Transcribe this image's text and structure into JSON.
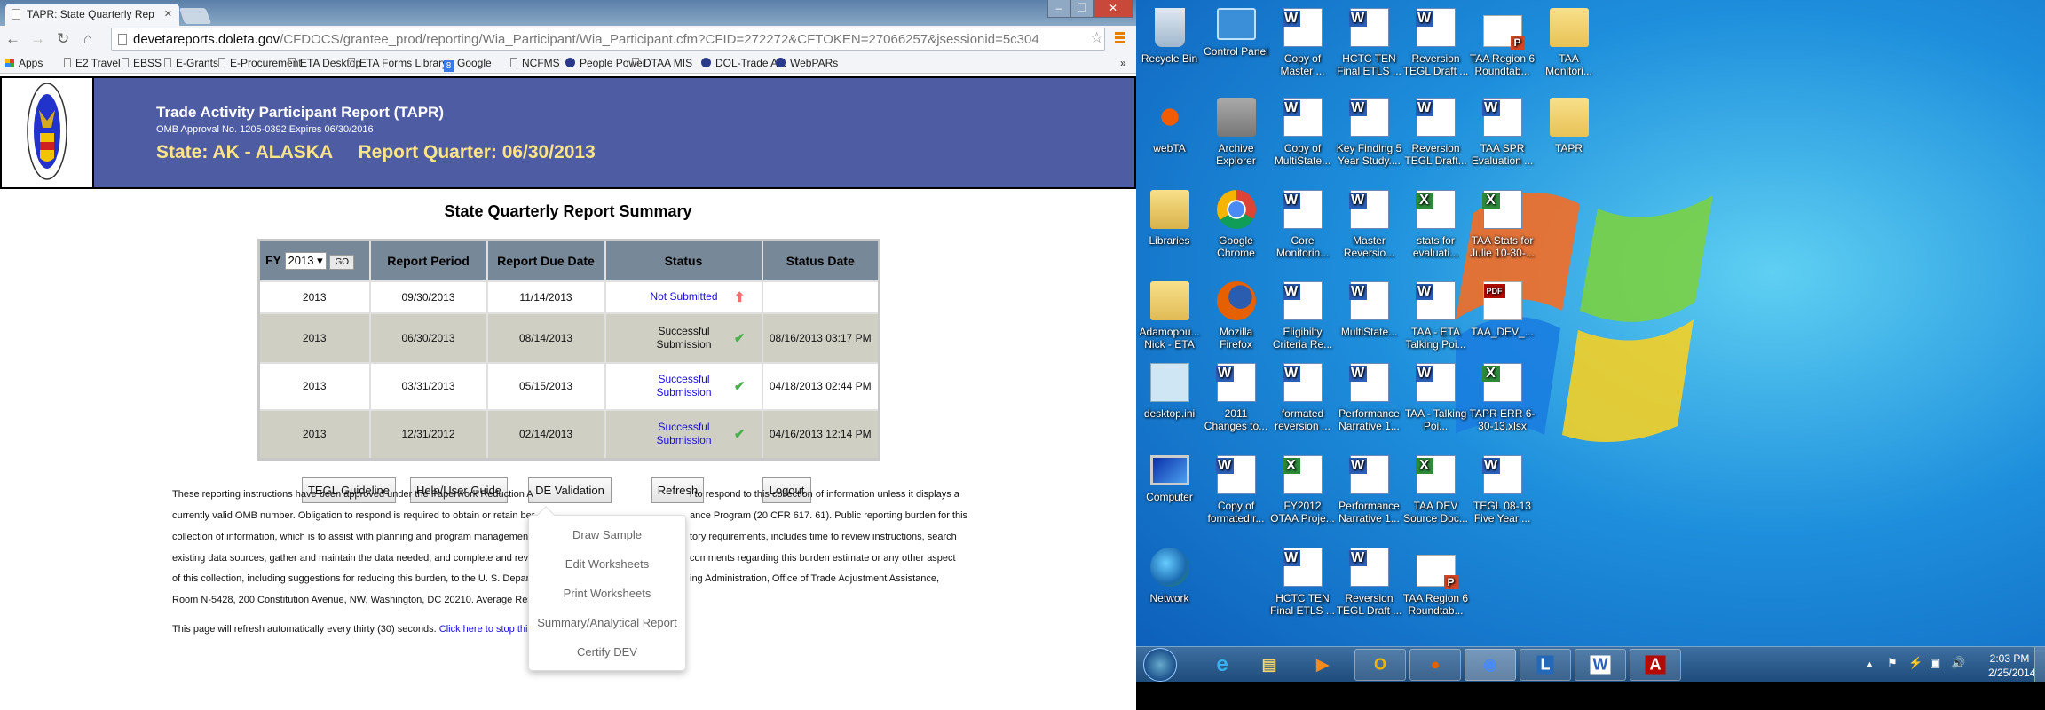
{
  "browser": {
    "tab_title": "TAPR: State Quarterly Rep",
    "url_host": "devetareports.doleta.gov",
    "url_path": "/CFDOCS/grantee_prod/reporting/Wia_Participant/Wia_Participant.cfm?CFID=272272&CFTOKEN=27066257&jsessionid=5c304",
    "bookmarks": [
      "Apps",
      "E2 Travel",
      "EBSS",
      "E-Grants",
      "E-Procurement",
      "ETA Desktop",
      "ETA Forms Library",
      "Google",
      "NCFMS",
      "People Power",
      "DTAA MIS",
      "DOL-Trade Act",
      "WebPARs"
    ],
    "more": "»"
  },
  "banner": {
    "title": "Trade Activity Participant Report (TAPR)",
    "omb": "OMB Approval No. 1205-0392    Expires 06/30/2016",
    "state_line": "State: AK - ALASKA     Report Quarter: 06/30/2013",
    "seal_text": "DEPARTMENT OF LABOR · UNITED STATES OF AMERICA"
  },
  "summary": {
    "title": "State Quarterly Report Summary",
    "fy_label": "FY",
    "fy_value": "2013",
    "go_label": "GO",
    "headers": [
      "Report Period",
      "Report Due Date",
      "Status",
      "Status Date"
    ],
    "rows": [
      {
        "fy": "2013",
        "period": "09/30/2013",
        "due": "11/14/2013",
        "status": "Not Submitted",
        "status_link": true,
        "icon": "arrow-up-icon",
        "date": ""
      },
      {
        "fy": "2013",
        "period": "06/30/2013",
        "due": "08/14/2013",
        "status": "Successful Submission",
        "status_link": false,
        "icon": "check-icon",
        "date": "08/16/2013 03:17 PM"
      },
      {
        "fy": "2013",
        "period": "03/31/2013",
        "due": "05/15/2013",
        "status": "Successful Submission",
        "status_link": true,
        "icon": "check-icon",
        "date": "04/18/2013 02:44 PM"
      },
      {
        "fy": "2013",
        "period": "12/31/2012",
        "due": "02/14/2013",
        "status": "Successful Submission",
        "status_link": true,
        "icon": "check-icon",
        "date": "04/16/2013 12:14 PM"
      }
    ]
  },
  "buttons": {
    "tegl": "TEGL Guideline",
    "help": "Help/User Guide",
    "de": "DE Validation",
    "refresh": "Refresh",
    "logout": "Logout"
  },
  "de_menu": [
    "Draw Sample",
    "Edit Worksheets",
    "Print Worksheets",
    "Summary/Analytical Report",
    "Certify DEV"
  ],
  "footer": {
    "lines": [
      [
        "These reporting instructions have been approved under the Paperwork Reduction A",
        "l to respond to this collection of information unless it displays a"
      ],
      [
        "currently valid OMB number. Obligation to respond is required to obtain or retain ber",
        "ance Program (20 CFR 617. 61). Public reporting burden for this"
      ],
      [
        "collection of information, which is to assist with planning and program management",
        "tory requirements, includes time to review instructions, search"
      ],
      [
        "existing data sources, gather and maintain the data needed, and complete and revie",
        "comments regarding this burden estimate or any other aspect"
      ],
      [
        "of this collection, including suggestions for reducing this burden, to the U. S. Depart",
        "ing Administration, Office of Trade Adjustment Assistance,"
      ],
      [
        "Room N-5428, 200 Constitution Avenue, NW, Washington, DC 20210. Average Resp",
        ""
      ]
    ],
    "refresh_text": "This page will refresh automatically every thirty (30) seconds. ",
    "refresh_link": "Click here to stop this refresh."
  },
  "desktop": {
    "icons": [
      {
        "r": 0,
        "c": 0,
        "type": "recycle",
        "label": "Recycle Bin"
      },
      {
        "r": 0,
        "c": 1,
        "type": "control",
        "label": "Control Panel"
      },
      {
        "r": 0,
        "c": 2,
        "type": "word",
        "label": "Copy of Master ..."
      },
      {
        "r": 0,
        "c": 3,
        "type": "word",
        "label": "HCTC TEN Final ETLS ..."
      },
      {
        "r": 0,
        "c": 4,
        "type": "word",
        "label": "Reversion TEGL Draft ..."
      },
      {
        "r": 0,
        "c": 5,
        "type": "ppt",
        "label": "TAA Region 6 Roundtab..."
      },
      {
        "r": 0,
        "c": 6,
        "type": "folder",
        "label": "TAA Monitori..."
      },
      {
        "r": 1,
        "c": 0,
        "type": "webta",
        "label": "webTA"
      },
      {
        "r": 1,
        "c": 1,
        "type": "archive",
        "label": "Archive Explorer"
      },
      {
        "r": 1,
        "c": 2,
        "type": "word",
        "label": "Copy of MultiState..."
      },
      {
        "r": 1,
        "c": 3,
        "type": "word",
        "label": "Key Finding 5 Year Study...."
      },
      {
        "r": 1,
        "c": 4,
        "type": "word",
        "label": "Reversion TEGL Draft..."
      },
      {
        "r": 1,
        "c": 5,
        "type": "word",
        "label": "TAA SPR Evaluation ..."
      },
      {
        "r": 1,
        "c": 6,
        "type": "folder",
        "label": "TAPR"
      },
      {
        "r": 2,
        "c": 0,
        "type": "libraries",
        "label": "Libraries"
      },
      {
        "r": 2,
        "c": 1,
        "type": "chrome",
        "label": "Google Chrome"
      },
      {
        "r": 2,
        "c": 2,
        "type": "word",
        "label": "Core Monitorin..."
      },
      {
        "r": 2,
        "c": 3,
        "type": "word",
        "label": "Master Reversio..."
      },
      {
        "r": 2,
        "c": 4,
        "type": "excel",
        "label": "stats for evaluati..."
      },
      {
        "r": 2,
        "c": 5,
        "type": "excel",
        "label": "TAA Stats for Julie 10-30-..."
      },
      {
        "r": 3,
        "c": 0,
        "type": "user",
        "label": "Adamopou... Nick - ETA"
      },
      {
        "r": 3,
        "c": 1,
        "type": "firefox",
        "label": "Mozilla Firefox"
      },
      {
        "r": 3,
        "c": 2,
        "type": "word",
        "label": "Eligibilty Criteria Re..."
      },
      {
        "r": 3,
        "c": 3,
        "type": "word",
        "label": "MultiState..."
      },
      {
        "r": 3,
        "c": 4,
        "type": "word",
        "label": "TAA - ETA Talking Poi..."
      },
      {
        "r": 3,
        "c": 5,
        "type": "pdf",
        "label": "TAA_DEV_..."
      },
      {
        "r": 4,
        "c": 0,
        "type": "ini",
        "label": "desktop.ini"
      },
      {
        "r": 4,
        "c": 1,
        "type": "word",
        "label": "2011 Changes to..."
      },
      {
        "r": 4,
        "c": 2,
        "type": "word",
        "label": "formated reversion ..."
      },
      {
        "r": 4,
        "c": 3,
        "type": "word",
        "label": "Performance Narrative 1..."
      },
      {
        "r": 4,
        "c": 4,
        "type": "word",
        "label": "TAA - Talking Poi..."
      },
      {
        "r": 4,
        "c": 5,
        "type": "excel",
        "label": "TAPR ERR 6-30-13.xlsx"
      },
      {
        "r": 5,
        "c": 0,
        "type": "computer",
        "label": "Computer"
      },
      {
        "r": 5,
        "c": 1,
        "type": "word",
        "label": "Copy of formated r..."
      },
      {
        "r": 5,
        "c": 2,
        "type": "excel",
        "label": "FY2012 OTAA Proje..."
      },
      {
        "r": 5,
        "c": 3,
        "type": "word",
        "label": "Performance Narrative 1..."
      },
      {
        "r": 5,
        "c": 4,
        "type": "excel",
        "label": "TAA DEV Source Doc..."
      },
      {
        "r": 5,
        "c": 5,
        "type": "word",
        "label": "TEGL 08-13 Five Year ..."
      },
      {
        "r": 6,
        "c": 0,
        "type": "network",
        "label": "Network"
      },
      {
        "r": 6,
        "c": 2,
        "type": "word",
        "label": "HCTC TEN Final ETLS ..."
      },
      {
        "r": 6,
        "c": 3,
        "type": "word",
        "label": "Reversion TEGL Draft ..."
      },
      {
        "r": 6,
        "c": 4,
        "type": "ppt",
        "label": "TAA Region 6 Roundtab..."
      }
    ]
  },
  "taskbar": {
    "pinned": [
      "internet-explorer",
      "windows-explorer",
      "media-player"
    ],
    "running": [
      "outlook",
      "firefox",
      "chrome",
      "lync",
      "word",
      "acrobat"
    ],
    "time": "2:03 PM",
    "date": "2/25/2014"
  },
  "colors": {
    "banner": "#4e5ca3",
    "banner_highlight": "#fce588",
    "table_header": "#778899",
    "stripe": "#cfcfc4",
    "link": "#1a0ddd",
    "check": "#4caf50",
    "arrow": "#f07070"
  }
}
